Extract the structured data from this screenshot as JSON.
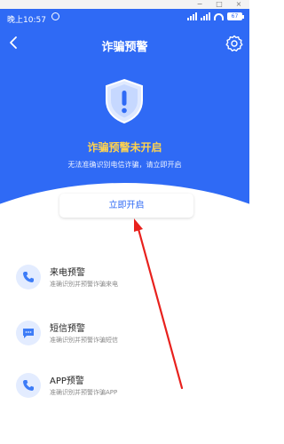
{
  "status_bar": {
    "time": "晚上10:57",
    "signal_label": "4G",
    "battery": "67"
  },
  "header": {
    "title": "诈骗预警",
    "back_icon": "chevron-left-icon",
    "settings_icon": "gear-icon"
  },
  "alert": {
    "title": "诈骗预警未开启",
    "subtitle": "无法准确识别电信诈骗，请立即开启",
    "button_label": "立即开启",
    "shield_icon": "shield-exclamation-icon"
  },
  "features": [
    {
      "title": "来电预警",
      "description": "准确识别并预警诈骗来电",
      "icon": "phone-icon"
    },
    {
      "title": "短信预警",
      "description": "准确识别并预警诈骗短信",
      "icon": "message-icon"
    },
    {
      "title": "APP预警",
      "description": "准确识别并预警诈骗APP",
      "icon": "phone-icon"
    }
  ],
  "colors": {
    "primary": "#2f6af5",
    "warning_text": "#ffd34f",
    "annotation": "#e8211d",
    "icon_bg": "#e3ecff"
  }
}
